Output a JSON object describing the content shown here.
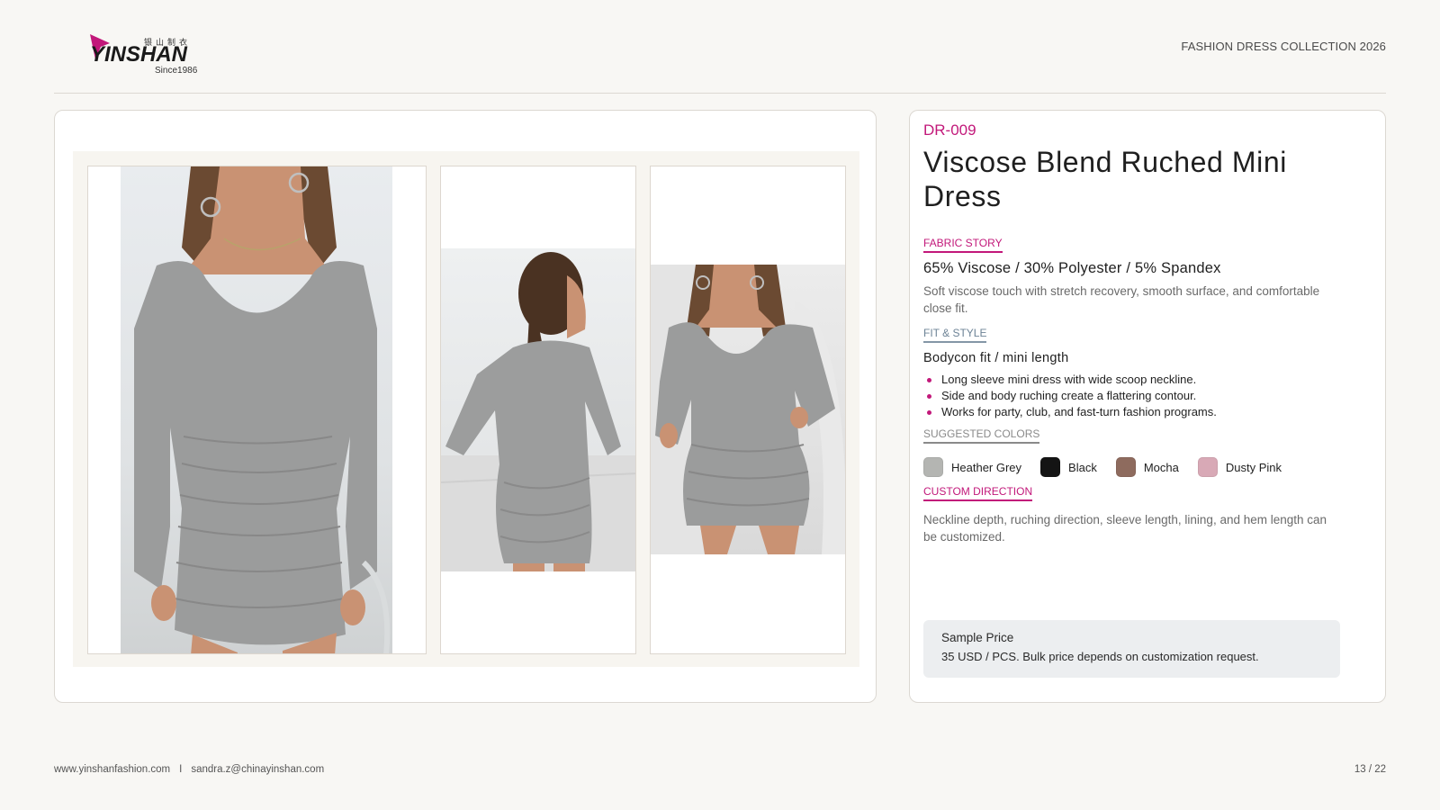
{
  "brand": {
    "logo_cn": "银山制衣",
    "logo_name": "YINSHAN",
    "logo_since": "Since1986"
  },
  "header": {
    "collection_title": "FASHION DRESS COLLECTION 2026"
  },
  "gallery": {
    "photos": [
      {
        "icon": "dress-front-photo"
      },
      {
        "icon": "dress-back-photo"
      },
      {
        "icon": "dress-seated-photo"
      }
    ]
  },
  "product": {
    "code": "DR-009",
    "title": "Viscose Blend Ruched Mini Dress",
    "fabric": {
      "label": "FABRIC STORY",
      "composition": "65% Viscose / 30% Polyester / 5% Spandex",
      "description": "Soft viscose touch with stretch recovery, smooth surface, and comfortable close fit."
    },
    "fit": {
      "label": "FIT & STYLE",
      "summary": "Bodycon fit / mini length",
      "bullets": [
        "Long sleeve mini dress with wide scoop neckline.",
        "Side and body ruching create a flattering contour.",
        "Works for party, club, and fast-turn fashion programs."
      ]
    },
    "colors": {
      "label": "SUGGESTED COLORS",
      "items": [
        {
          "name": "Heather Grey",
          "hex": "#b4b5b2"
        },
        {
          "name": "Black",
          "hex": "#141414"
        },
        {
          "name": "Mocha",
          "hex": "#8e6b5e"
        },
        {
          "name": "Dusty Pink",
          "hex": "#d8a9b6"
        }
      ]
    },
    "custom": {
      "label": "CUSTOM DIRECTION",
      "description": "Neckline depth, ruching direction, sleeve length, lining, and hem length can be customized."
    },
    "price": {
      "title": "Sample Price",
      "text": "35 USD / PCS. Bulk price depends on customization request."
    }
  },
  "footer": {
    "website": "www.yinshanfashion.com",
    "separator": "I",
    "email": "sandra.z@chinayinshan.com",
    "page": "13 / 22"
  },
  "colors": {
    "accent": "#c2187a",
    "secondary": "#6d8396",
    "background": "#f8f7f4"
  }
}
